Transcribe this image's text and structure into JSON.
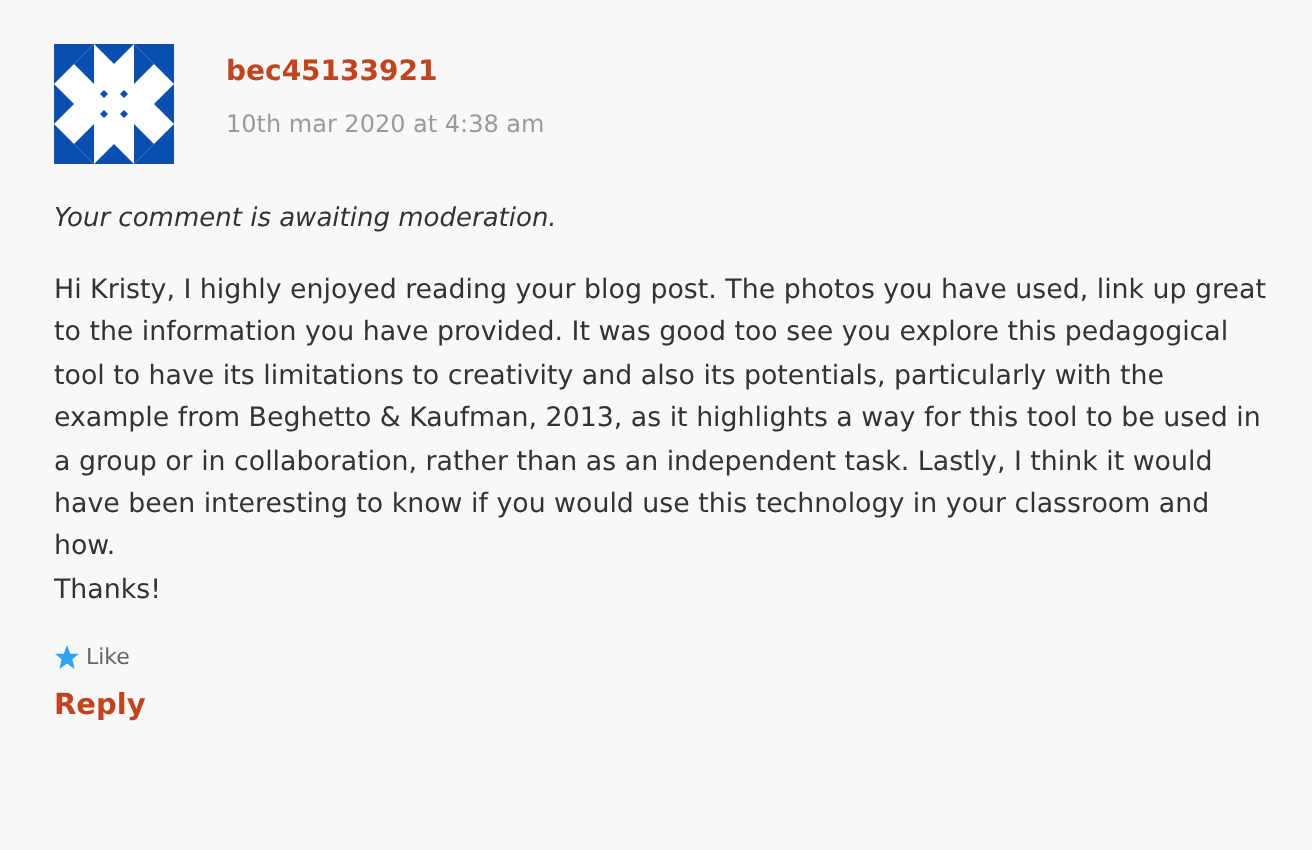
{
  "comment": {
    "author": "bec45133921",
    "date": "10th mar 2020 at 4:38 am",
    "moderation_notice": "Your comment is awaiting moderation.",
    "body": [
      "Hi Kristy, I highly enjoyed reading your blog post. The photos you have used, link up great to the information you have provided. It was good too see you explore this pedagogical tool to have its limitations to creativity and also its potentials, particularly with the example from Beghetto & Kaufman, 2013, as it highlights a way for this tool to be used in a group or in collaboration, rather than as an independent task. Lastly, I think it would have been interesting to know if you would use this technology in your classroom and how.",
      "Thanks!"
    ],
    "like": {
      "label": "Like"
    },
    "reply": "Reply"
  }
}
